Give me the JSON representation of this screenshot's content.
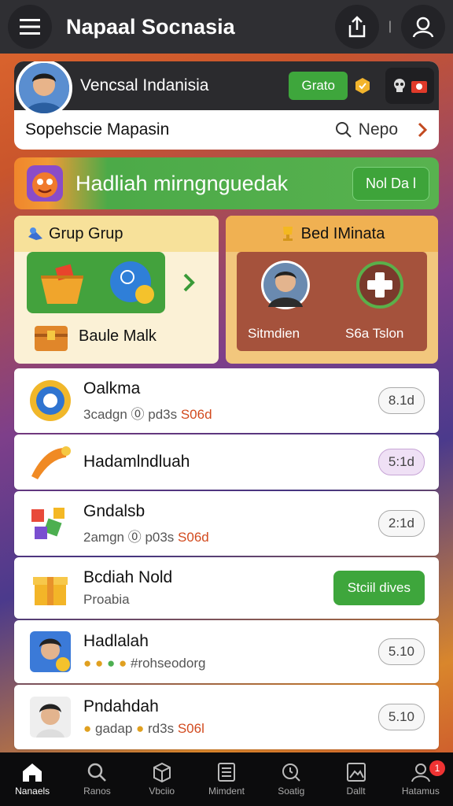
{
  "app": {
    "title": "Napaal Socnasia"
  },
  "topbar": {
    "menu_icon": "hamburger-icon",
    "share_icon": "share-icon",
    "profile_icon": "user-icon"
  },
  "profile": {
    "name": "Vencsal Indanisia",
    "status_button": "Grato",
    "search_label": "Sopehscie Mapasin",
    "search_value": "Nepo"
  },
  "banner": {
    "text": "Hadliah mirngnguedak",
    "button": "Nol Da l"
  },
  "card_left": {
    "title": "Grup Grup",
    "footer_label": "Baule Malk"
  },
  "card_right": {
    "title": "Bed IMinata",
    "label_left": "Sitmdien",
    "label_right": "S6a Tslon"
  },
  "list": [
    {
      "title": "Oalkma",
      "sub_prefix": "3cadgn",
      "sub_mid": "⓪ pd3s",
      "sub_accent": "S06d",
      "badge": "8.1d",
      "badge_style": "grey"
    },
    {
      "title": "Hadamlndluah",
      "badge": "5:1d",
      "badge_style": "purple"
    },
    {
      "title": "Gndalsb",
      "sub_prefix": "2amgn",
      "sub_mid": "⓪ p03s",
      "sub_accent": "S06d",
      "badge": "2:1d",
      "badge_style": "grey"
    },
    {
      "title": "Bcdiah Nold",
      "sub_prefix": "Proabia",
      "badge": "Stciil dives",
      "badge_style": "green"
    },
    {
      "title": "Hadlalah",
      "sub_prefix": "#rohseodorg",
      "badge": "5.10",
      "badge_style": "grey"
    },
    {
      "title": "Pndahdah",
      "sub_prefix": "gadap",
      "sub_mid": "rd3s",
      "sub_accent": "S06l",
      "badge": "5.10",
      "badge_style": "grey"
    }
  ],
  "nav": [
    {
      "label": "Nanaels",
      "icon": "home-icon"
    },
    {
      "label": "Ranos",
      "icon": "search-icon"
    },
    {
      "label": "Vbciio",
      "icon": "box-icon"
    },
    {
      "label": "Mimdent",
      "icon": "list-icon"
    },
    {
      "label": "Soatig",
      "icon": "search-clock-icon"
    },
    {
      "label": "Dallt",
      "icon": "image-icon"
    },
    {
      "label": "Hatamus",
      "icon": "person-icon",
      "badge": "1"
    }
  ],
  "colors": {
    "green": "#3ea63c",
    "orange": "#f0862c",
    "dark": "#2f2f33",
    "accent_red": "#d24a1e"
  }
}
